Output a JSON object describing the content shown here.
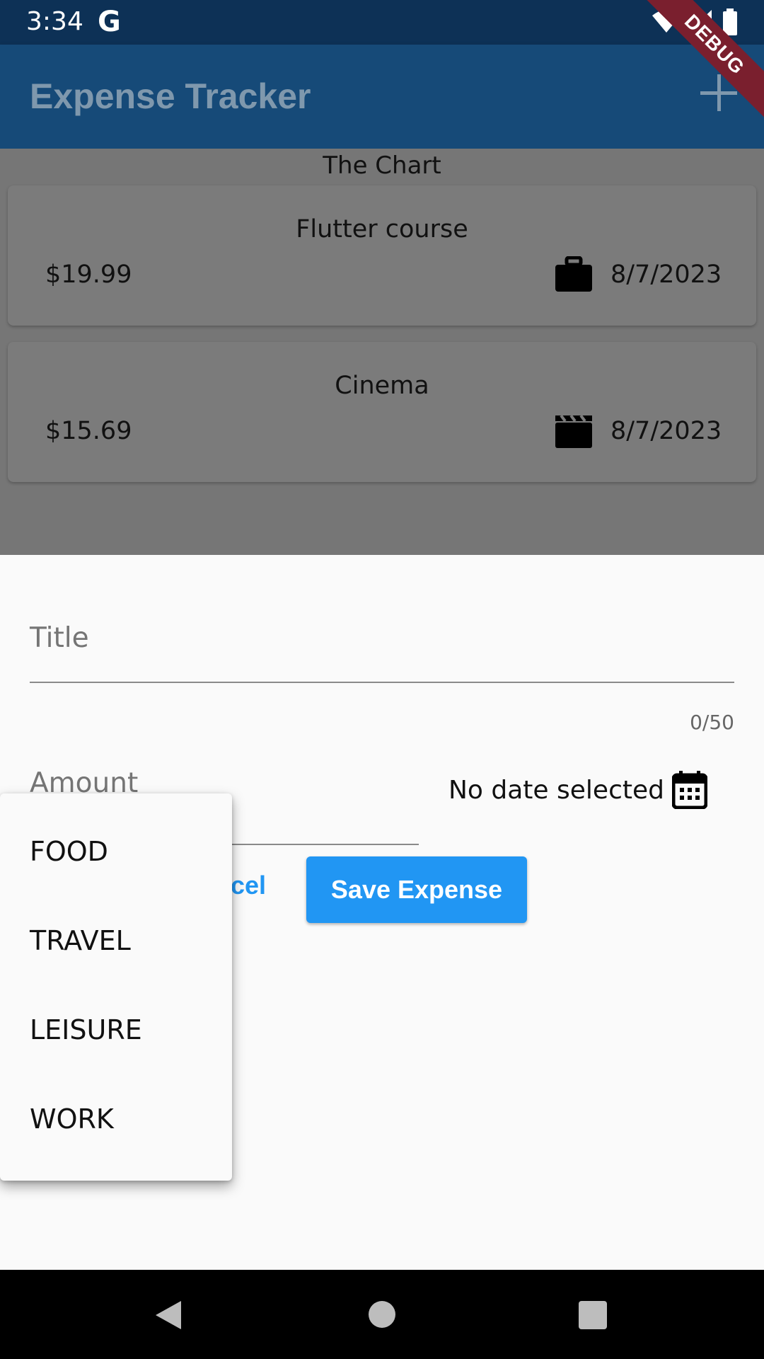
{
  "status_bar": {
    "time": "3:34",
    "g_logo": "G"
  },
  "app_bar": {
    "title": "Expense Tracker",
    "add_icon": "plus-icon"
  },
  "debug_banner": "DEBUG",
  "chart_placeholder": "The Chart",
  "expenses": [
    {
      "title": "Flutter course",
      "amount": "$19.99",
      "date": "8/7/2023",
      "icon": "briefcase-icon"
    },
    {
      "title": "Cinema",
      "amount": "$15.69",
      "date": "8/7/2023",
      "icon": "movie-icon"
    }
  ],
  "form": {
    "title_placeholder": "Title",
    "title_counter": "0/50",
    "amount_placeholder": "Amount",
    "date_text": "No date selected",
    "cancel_label": "Cancel",
    "save_label": "Save Expense"
  },
  "category_menu": [
    "FOOD",
    "TRAVEL",
    "LEISURE",
    "WORK"
  ],
  "colors": {
    "accent": "#2196f3",
    "app_bar": "#164a78",
    "status_bar": "#0d3156",
    "debug_ribbon": "#7a1f2e"
  }
}
